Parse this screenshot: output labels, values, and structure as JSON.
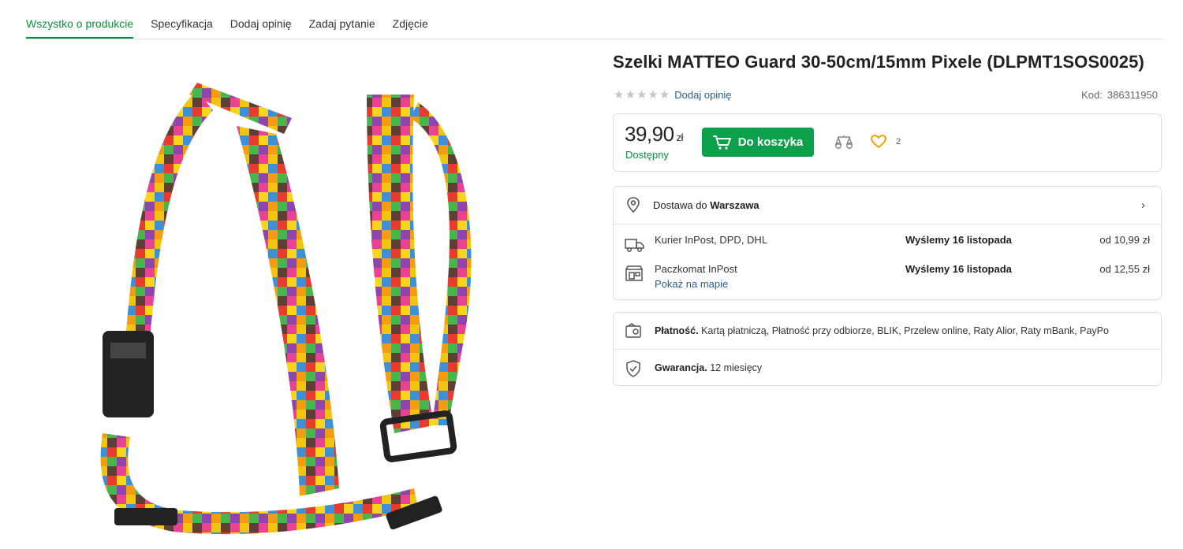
{
  "tabs": [
    {
      "label": "Wszystko o produkcie",
      "active": true
    },
    {
      "label": "Specyfikacja"
    },
    {
      "label": "Dodaj opinię"
    },
    {
      "label": "Zadaj pytanie"
    },
    {
      "label": "Zdjęcie"
    }
  ],
  "product": {
    "title": "Szelki MATTEO Guard 30-50cm/15mm Pixele (DLPMT1SOS0025)",
    "rating_stars": 0,
    "add_review": "Dodaj opinię",
    "code_label": "Kod:",
    "code_value": "386311950",
    "image_icon": "pet-harness-image"
  },
  "buy": {
    "price": "39,90",
    "currency": "zł",
    "availability": "Dostępny",
    "cart_label": "Do koszyka",
    "favorites_count": "2"
  },
  "delivery": {
    "header_prefix": "Dostawa do",
    "city": "Warszawa",
    "options": [
      {
        "icon": "truck-icon",
        "name": "Kurier InPost, DPD, DHL",
        "when": "Wyślemy 16 listopada",
        "cost": "od 10,99 zł"
      },
      {
        "icon": "parcel-locker-icon",
        "name": "Paczkomat InPost",
        "link": "Pokaż na mapie",
        "when": "Wyślemy 16 listopada",
        "cost": "od 12,55 zł"
      }
    ]
  },
  "payment": {
    "label": "Płatność.",
    "methods": "Kartą płatniczą, Płatność przy odbiorze, BLIK, Przelew online, Raty Alior, Raty mBank, PayPo"
  },
  "warranty": {
    "label": "Gwarancja.",
    "value": "12 miesięcy"
  },
  "colors": {
    "accent": "#0aa14a",
    "link": "#2b5f8f",
    "available": "#0a8f3c",
    "heart": "#f0a300"
  }
}
